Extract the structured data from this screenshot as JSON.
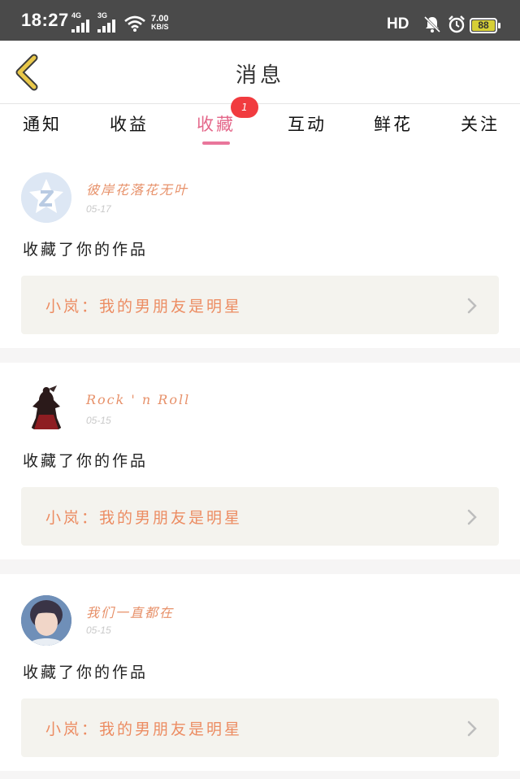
{
  "status_bar": {
    "time": "18:27",
    "signal1_label": "4G",
    "signal2_label": "3G",
    "net_speed_value": "7.00",
    "net_speed_unit": "KB/S",
    "hd_label": "HD",
    "battery_level": "88",
    "battery_color": "#d6cf36"
  },
  "header": {
    "title": "消息",
    "back_icon": "chevron-left-icon",
    "back_icon_color": "#e9c84a"
  },
  "tabs": [
    {
      "label": "通知",
      "active": false
    },
    {
      "label": "收益",
      "active": false
    },
    {
      "label": "收藏",
      "active": true,
      "badge": "1"
    },
    {
      "label": "互动",
      "active": false
    },
    {
      "label": "鲜花",
      "active": false
    },
    {
      "label": "关注",
      "active": false
    }
  ],
  "accent_color": "#e4678a",
  "messages": [
    {
      "user_name": "彼岸花落花无叶",
      "date": "05-17",
      "action": "收藏了你的作品",
      "work_title": "小岚：我的男朋友是明星",
      "avatar": "default-avatar-icon"
    },
    {
      "user_name": "Rock ' n Roll",
      "date": "05-15",
      "action": "收藏了你的作品",
      "work_title": "小岚：我的男朋友是明星",
      "avatar": "dark-figure-avatar"
    },
    {
      "user_name": "我们一直都在",
      "date": "05-15",
      "action": "收藏了你的作品",
      "work_title": "小岚：我的男朋友是明星",
      "avatar": "photo-avatar"
    }
  ]
}
